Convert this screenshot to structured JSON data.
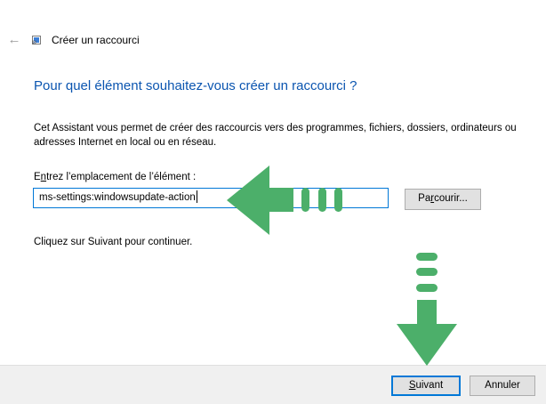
{
  "window": {
    "title": "Créer un raccourci",
    "back_icon": "back-arrow-icon",
    "app_icon": "shortcut-icon"
  },
  "main": {
    "heading": "Pour quel élément souhaitez-vous créer un raccourci ?",
    "description": "Cet Assistant vous permet de créer des raccourcis vers des programmes, fichiers, dossiers, ordinateurs ou adresses Internet en local ou en réseau.",
    "field_label_pre": "E",
    "field_label_accel": "n",
    "field_label_post": "trez l’emplacement de l’élément :",
    "path_value": "ms-settings:windowsupdate-action",
    "browse_pre": "Pa",
    "browse_accel": "r",
    "browse_post": "courir...",
    "hint": "Cliquez sur Suivant pour continuer."
  },
  "footer": {
    "next_accel": "S",
    "next_post": "uivant",
    "cancel_label": "Annuler"
  },
  "annotations": {
    "arrow_color": "#4caf6a",
    "left_arrow": "left-arrow-icon",
    "down_arrow": "down-arrow-icon"
  }
}
